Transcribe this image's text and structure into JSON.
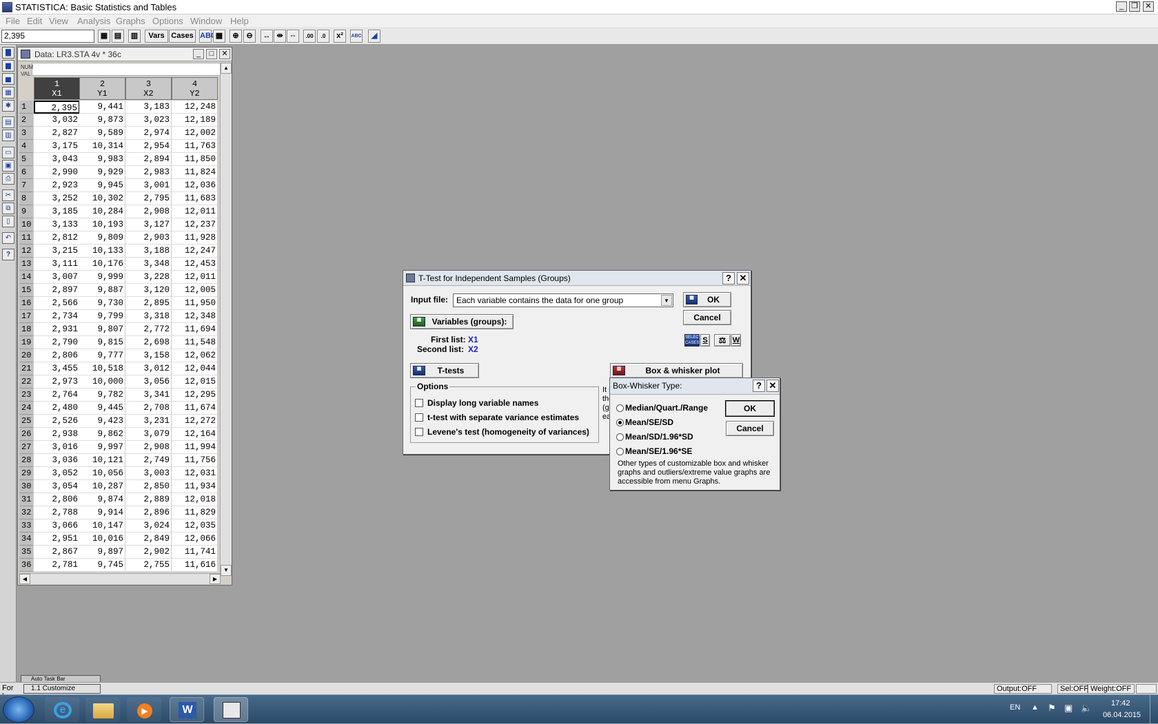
{
  "app": {
    "title": "STATISTICA: Basic Statistics and Tables",
    "cell_ref": "2,395"
  },
  "menu": [
    "File",
    "Edit",
    "View",
    "Analysis",
    "Graphs",
    "Options",
    "Window",
    "Help"
  ],
  "toolbar": {
    "vars": "Vars",
    "cases": "Cases"
  },
  "data_window": {
    "title": "Data: LR3.STA 4v * 36c",
    "numval": [
      "NUM",
      "VAL"
    ],
    "columns": [
      {
        "num": "1",
        "name": "X1"
      },
      {
        "num": "2",
        "name": "Y1"
      },
      {
        "num": "3",
        "name": "X2"
      },
      {
        "num": "4",
        "name": "Y2"
      }
    ],
    "rows": [
      [
        "2,395",
        "9,441",
        "3,183",
        "12,248"
      ],
      [
        "3,032",
        "9,873",
        "3,023",
        "12,189"
      ],
      [
        "2,827",
        "9,589",
        "2,974",
        "12,002"
      ],
      [
        "3,175",
        "10,314",
        "2,954",
        "11,763"
      ],
      [
        "3,043",
        "9,983",
        "2,894",
        "11,850"
      ],
      [
        "2,990",
        "9,929",
        "2,983",
        "11,824"
      ],
      [
        "2,923",
        "9,945",
        "3,001",
        "12,036"
      ],
      [
        "3,252",
        "10,302",
        "2,795",
        "11,683"
      ],
      [
        "3,185",
        "10,284",
        "2,908",
        "12,011"
      ],
      [
        "3,133",
        "10,193",
        "3,127",
        "12,237"
      ],
      [
        "2,812",
        "9,809",
        "2,903",
        "11,928"
      ],
      [
        "3,215",
        "10,133",
        "3,188",
        "12,247"
      ],
      [
        "3,111",
        "10,176",
        "3,348",
        "12,453"
      ],
      [
        "3,007",
        "9,999",
        "3,228",
        "12,011"
      ],
      [
        "2,897",
        "9,887",
        "3,120",
        "12,005"
      ],
      [
        "2,566",
        "9,730",
        "2,895",
        "11,950"
      ],
      [
        "2,734",
        "9,799",
        "3,318",
        "12,348"
      ],
      [
        "2,931",
        "9,807",
        "2,772",
        "11,694"
      ],
      [
        "2,790",
        "9,815",
        "2,698",
        "11,548"
      ],
      [
        "2,806",
        "9,777",
        "3,158",
        "12,062"
      ],
      [
        "3,455",
        "10,518",
        "3,012",
        "12,044"
      ],
      [
        "2,973",
        "10,000",
        "3,056",
        "12,015"
      ],
      [
        "2,764",
        "9,782",
        "3,341",
        "12,295"
      ],
      [
        "2,480",
        "9,445",
        "2,708",
        "11,674"
      ],
      [
        "2,526",
        "9,423",
        "3,231",
        "12,272"
      ],
      [
        "2,938",
        "9,862",
        "3,079",
        "12,164"
      ],
      [
        "3,016",
        "9,997",
        "2,908",
        "11,994"
      ],
      [
        "3,036",
        "10,121",
        "2,749",
        "11,756"
      ],
      [
        "3,052",
        "10,056",
        "3,003",
        "12,031"
      ],
      [
        "3,054",
        "10,287",
        "2,850",
        "11,934"
      ],
      [
        "2,806",
        "9,874",
        "2,889",
        "12,018"
      ],
      [
        "2,788",
        "9,914",
        "2,896",
        "11,829"
      ],
      [
        "3,066",
        "10,147",
        "3,024",
        "12,035"
      ],
      [
        "2,951",
        "10,016",
        "2,849",
        "12,066"
      ],
      [
        "2,867",
        "9,897",
        "2,902",
        "11,741"
      ],
      [
        "2,781",
        "9,745",
        "2,755",
        "11,616"
      ]
    ]
  },
  "ttest": {
    "title": "T-Test for Independent Samples (Groups)",
    "input_label": "Input file:",
    "input_value": "Each variable contains the data for one group",
    "ok": "OK",
    "cancel": "Cancel",
    "variables_btn": "Variables (groups):",
    "first_list_label": "First list:",
    "first_list_value": "X1",
    "second_list_label": "Second list:",
    "second_list_value": "X2",
    "ttests_btn": "T-tests",
    "box_btn": "Box & whisker plot",
    "options_title": "Options",
    "options": [
      "Display long variable names",
      "t-test with separate variance estimates",
      "Levene's test (homogeneity of variances)"
    ],
    "side_text": [
      "It i",
      "the",
      "(gr",
      "ea"
    ],
    "select_cases_icon": [
      "SELECT",
      "CASES"
    ],
    "select_key": "S",
    "weight_key": "W"
  },
  "boxwhisker": {
    "title": "Box-Whisker Type:",
    "options": [
      "Median/Quart./Range",
      "Mean/SE/SD",
      "Mean/SD/1.96*SD",
      "Mean/SE/1.96*SE"
    ],
    "selected_index": 1,
    "ok": "OK",
    "cancel": "Cancel",
    "note": "Other types of customizable box and whisker graphs and outliers/extreme value graphs are accessible from menu Graphs."
  },
  "status": {
    "hint": "For h",
    "output": "Output:OFF",
    "sel": "Sel:OFF",
    "weight": "Weight:OFF"
  },
  "mini_toolbar": {
    "title": "Auto Task Bar",
    "item": "1.1 Customize"
  },
  "tray": {
    "lang": "EN",
    "time": "17:42",
    "date": "06.04.2015"
  }
}
